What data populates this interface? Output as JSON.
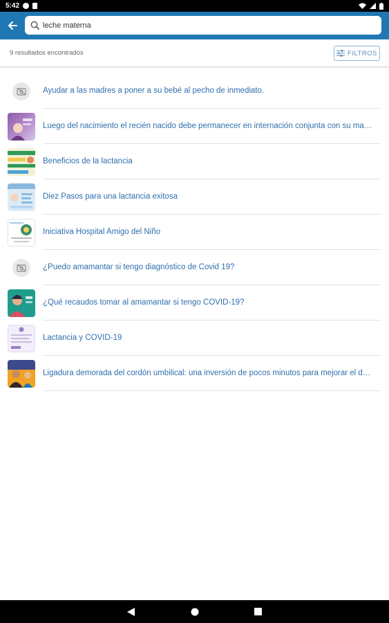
{
  "status_bar": {
    "time": "5:42",
    "icons": [
      "notification-icon",
      "sim-icon",
      "wifi-icon",
      "signal-icon",
      "battery-icon"
    ]
  },
  "app_bar": {
    "back_icon": "arrow-left-icon",
    "color": "#1f78b4",
    "search": {
      "value": "leche materna",
      "icon": "search-icon"
    }
  },
  "results": {
    "count_text": "9 resultados encontrados",
    "filter_label": "FILTROS",
    "filter_icon": "sliders-icon"
  },
  "items": [
    {
      "title": "Ayudar a las madres a poner a su bebé al pecho de inmediato.",
      "thumb": "placeholder"
    },
    {
      "title": "Luego del nacimiento el recién nacido debe permanecer en internación conjunta con su madre...",
      "thumb": "image",
      "colors": [
        "#8e5aa6",
        "#d7c6e6"
      ]
    },
    {
      "title": "Beneficios de la lactancia",
      "thumb": "image",
      "colors": [
        "#2f9b5a",
        "#f0c94a"
      ]
    },
    {
      "title": "Diez Pasos para una lactancia exitosa",
      "thumb": "image",
      "colors": [
        "#8ab8e0",
        "#dcebf7"
      ]
    },
    {
      "title": "Iniciativa Hospital Amigo del Niño",
      "thumb": "image",
      "colors": [
        "#ffffff",
        "#3a8f6d"
      ]
    },
    {
      "title": "¿Puedo amamantar si tengo diagnóstico de Covid 19?",
      "thumb": "placeholder"
    },
    {
      "title": "¿Qué recaudos tomar al amamantar si tengo COVID-19?",
      "thumb": "image",
      "colors": [
        "#1f9c8c",
        "#e7b089"
      ]
    },
    {
      "title": "Lactancia y COVID-19",
      "thumb": "image",
      "colors": [
        "#f2eefa",
        "#9b7fc4"
      ]
    },
    {
      "title": "Ligadura demorada del cordón umbilical: una inversión de pocos minutos para mejorar el desa...",
      "thumb": "image",
      "colors": [
        "#f0a224",
        "#3c4a8c"
      ]
    }
  ],
  "nav_bar": {
    "icons": [
      "back-triangle-icon",
      "home-circle-icon",
      "recents-square-icon"
    ]
  }
}
